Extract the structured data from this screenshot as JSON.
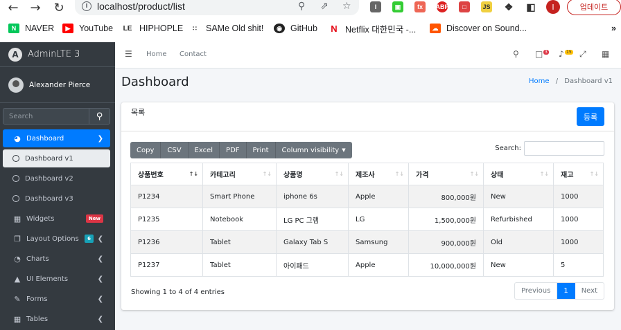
{
  "browser": {
    "url": "localhost/product/list",
    "update_label": "업데이트",
    "profile_initial": "I",
    "bookmarks": [
      "NAVER",
      "YouTube",
      "HIPHOPLE",
      "SAMe Old shit!",
      "GitHub",
      "Netflix 대한민국 -...",
      "Discover on Sound..."
    ]
  },
  "sidebar": {
    "brand": "AdminLTE 3",
    "user": "Alexander Pierce",
    "search_placeholder": "Search",
    "items": [
      {
        "label": "Dashboard"
      },
      {
        "label": "Dashboard v1"
      },
      {
        "label": "Dashboard v2"
      },
      {
        "label": "Dashboard v3"
      },
      {
        "label": "Widgets",
        "badge": "New"
      },
      {
        "label": "Layout Options",
        "badge": "6"
      },
      {
        "label": "Charts"
      },
      {
        "label": "UI Elements"
      },
      {
        "label": "Forms"
      },
      {
        "label": "Tables"
      }
    ]
  },
  "navbar": {
    "links": [
      "Home",
      "Contact"
    ],
    "messages_count": "3",
    "notifications_count": "15"
  },
  "page": {
    "title": "Dashboard",
    "breadcrumb_home": "Home",
    "breadcrumb_current": "Dashboard v1"
  },
  "card": {
    "title": "목록",
    "register_label": "등록",
    "buttons": [
      "Copy",
      "CSV",
      "Excel",
      "PDF",
      "Print",
      "Column visibility"
    ],
    "search_label": "Search:",
    "columns": [
      "상품번호",
      "카테고리",
      "상품명",
      "제조사",
      "가격",
      "상태",
      "재고"
    ],
    "rows": [
      [
        "P1234",
        "Smart Phone",
        "iphone 6s",
        "Apple",
        "800,000원",
        "New",
        "1000"
      ],
      [
        "P1235",
        "Notebook",
        "LG PC 그램",
        "LG",
        "1,500,000원",
        "Refurbished",
        "1000"
      ],
      [
        "P1236",
        "Tablet",
        "Galaxy Tab S",
        "Samsung",
        "900,000원",
        "Old",
        "1000"
      ],
      [
        "P1237",
        "Tablet",
        "아이패드",
        "Apple",
        "10,000,000원",
        "New",
        "5"
      ]
    ],
    "info": "Showing 1 to 4 of 4 entries",
    "pager": [
      "Previous",
      "1",
      "Next"
    ]
  }
}
